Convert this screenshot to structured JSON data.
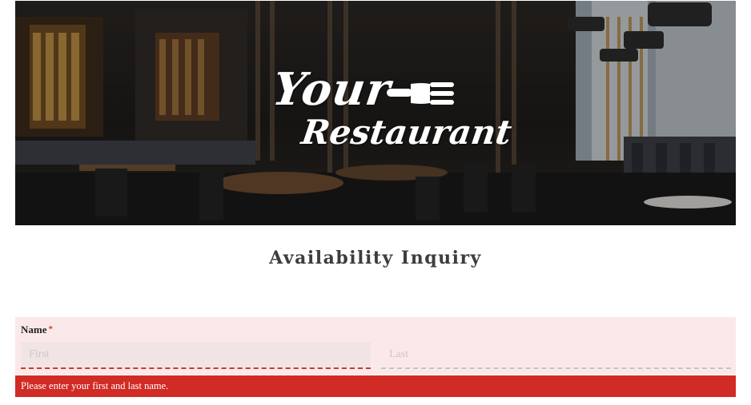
{
  "hero": {
    "logo_line1": "Your",
    "logo_line2": "Restaurant",
    "logo_icon": "fork-icon"
  },
  "page": {
    "title": "Availability Inquiry"
  },
  "form": {
    "name_field": {
      "label": "Name",
      "required_mark": "*",
      "first_placeholder": "First",
      "first_value": "",
      "last_placeholder": "Last",
      "last_value": ""
    },
    "error_message": "Please enter your first and last name."
  },
  "colors": {
    "error": "#d12b25",
    "field_error_bg": "#fbe9e9",
    "title": "#3d3d3d"
  }
}
